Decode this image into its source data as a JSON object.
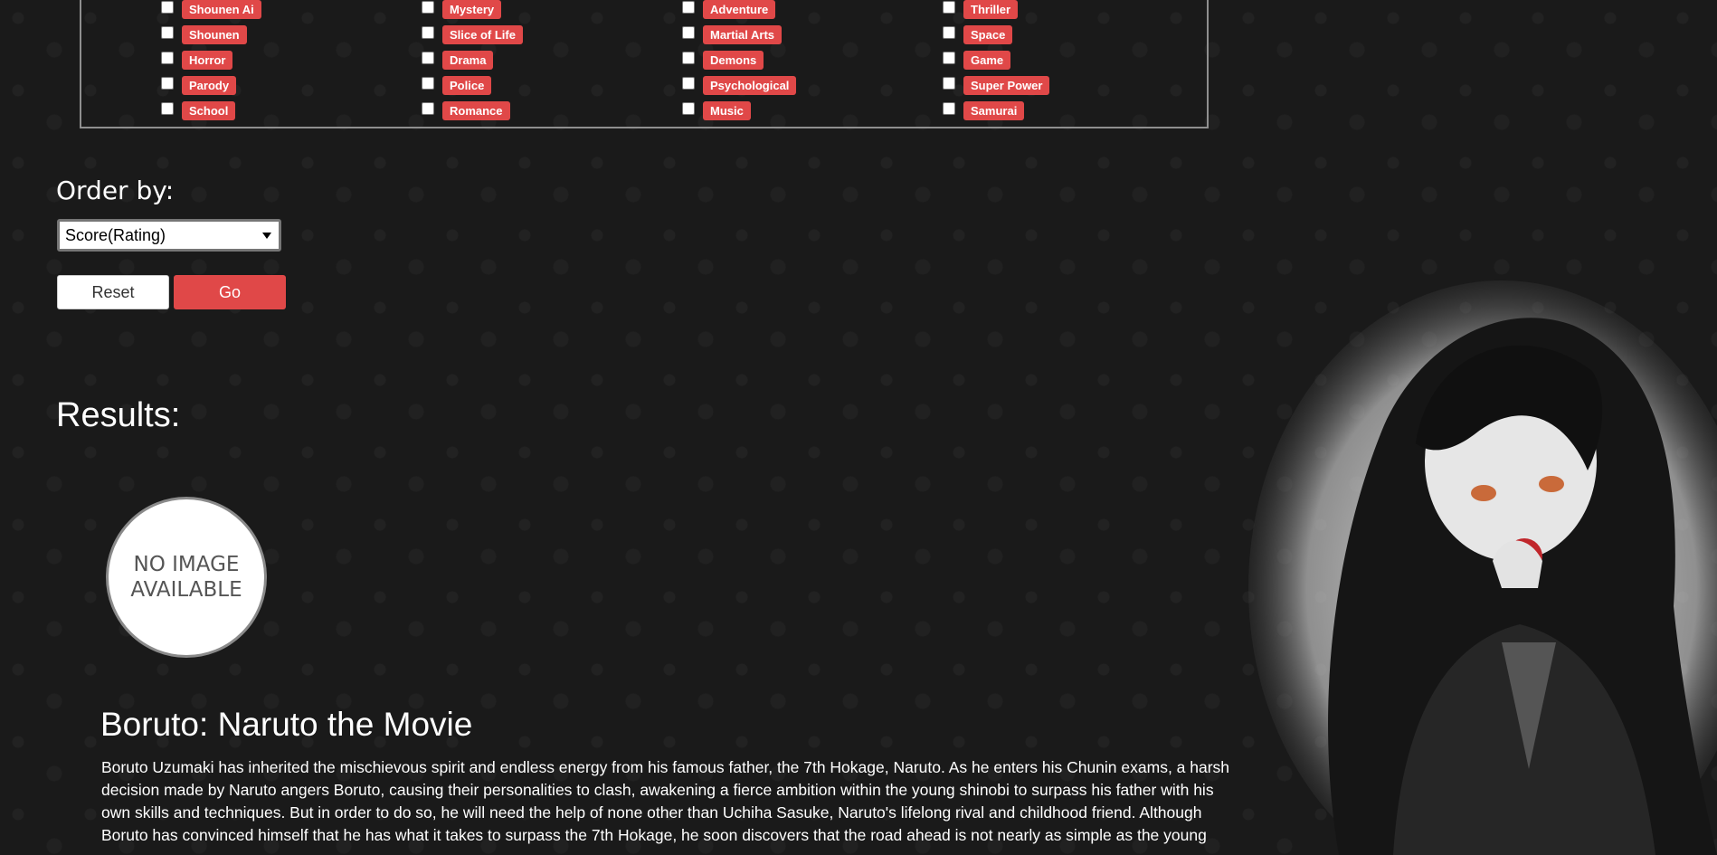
{
  "genres": [
    [
      "Shounen Ai",
      "Mystery",
      "Adventure",
      "Thriller"
    ],
    [
      "Shounen",
      "Slice of Life",
      "Martial Arts",
      "Space"
    ],
    [
      "Horror",
      "Drama",
      "Demons",
      "Game"
    ],
    [
      "Parody",
      "Police",
      "Psychological",
      "Super Power"
    ],
    [
      "School",
      "Romance",
      "Music",
      "Samurai"
    ]
  ],
  "order": {
    "label": "Order by:",
    "selected": "Score(Rating)"
  },
  "buttons": {
    "reset": "Reset",
    "go": "Go"
  },
  "results": {
    "heading": "Results:",
    "no_image_text": "NO IMAGE AVAILABLE",
    "items": [
      {
        "title": "Boruto: Naruto the Movie",
        "synopsis": "Boruto Uzumaki has inherited the mischievous spirit and endless energy from his famous father, the 7th Hokage, Naruto. As he enters his Chunin exams, a harsh decision made by Naruto angers Boruto, causing their personalities to clash, awakening a fierce ambition within the young shinobi to surpass his father with his own skills and techniques. But in order to do so, he will need the help of none other than Uchiha Sasuke, Naruto's lifelong rival and childhood friend. Although Boruto has convinced himself that he has what it takes to surpass the 7th Hokage, he soon discovers that the road ahead is not nearly as simple as the young"
      }
    ]
  },
  "colors": {
    "accent": "#e04848",
    "background": "#1a1a1a"
  }
}
